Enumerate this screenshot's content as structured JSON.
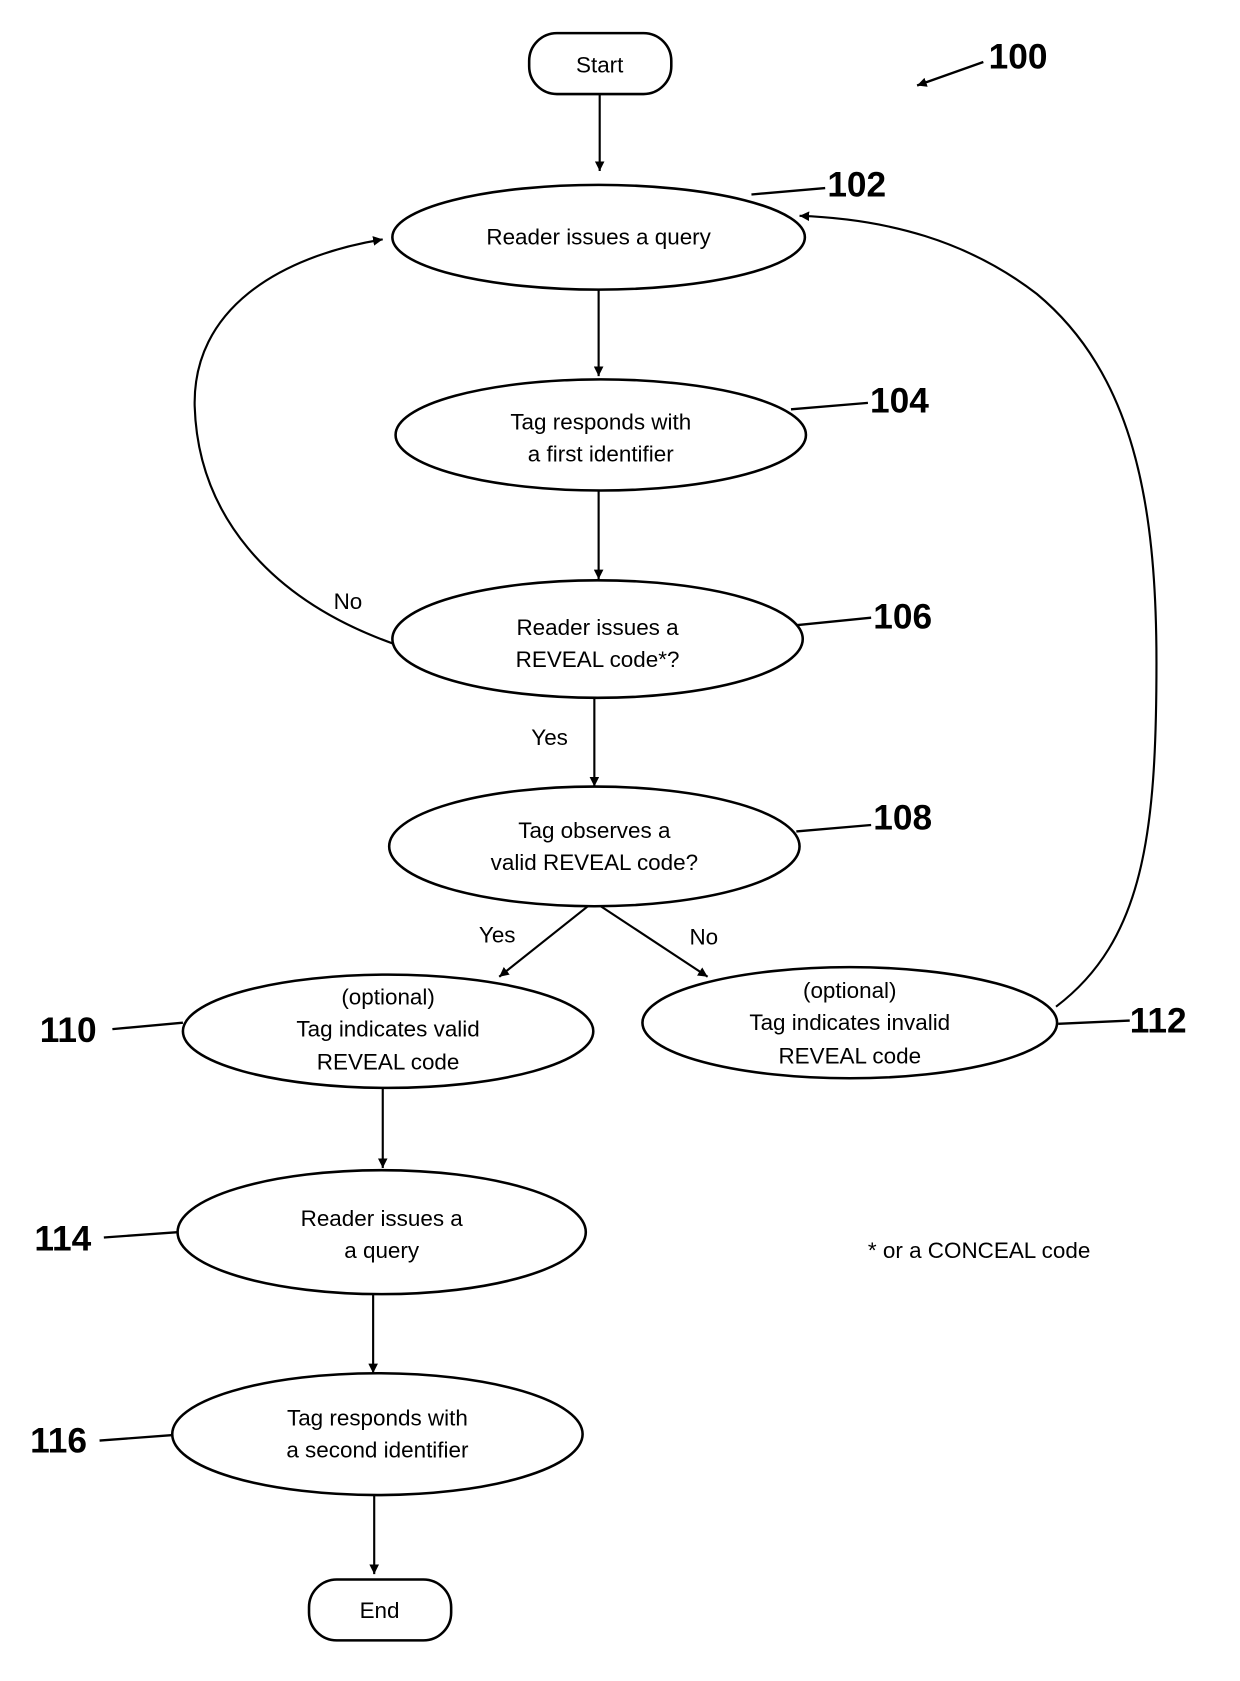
{
  "figure": {
    "reference": "100",
    "footnote": "* or a CONCEAL code"
  },
  "nodes": {
    "start": {
      "ref": "",
      "lines": [
        "Start"
      ]
    },
    "n102": {
      "ref": "102",
      "lines": [
        "Reader issues a query"
      ]
    },
    "n104": {
      "ref": "104",
      "lines": [
        "Tag responds with",
        "a first identifier"
      ]
    },
    "n106": {
      "ref": "106",
      "lines": [
        "Reader issues a",
        "REVEAL code*?"
      ]
    },
    "n108": {
      "ref": "108",
      "lines": [
        "Tag observes a",
        "valid REVEAL code?"
      ]
    },
    "n110": {
      "ref": "110",
      "lines": [
        "(optional)",
        "Tag indicates valid",
        "REVEAL code"
      ]
    },
    "n112": {
      "ref": "112",
      "lines": [
        "(optional)",
        "Tag indicates invalid",
        "REVEAL code"
      ]
    },
    "n114": {
      "ref": "114",
      "lines": [
        "Reader issues a",
        "a query"
      ]
    },
    "n116": {
      "ref": "116",
      "lines": [
        "Tag responds with",
        "a second identifier"
      ]
    },
    "end": {
      "ref": "",
      "lines": [
        "End"
      ]
    }
  },
  "edge_labels": {
    "n106_no": "No",
    "n106_yes": "Yes",
    "n108_yes": "Yes",
    "n108_no": "No"
  },
  "colors": {
    "ink": "#000000",
    "paper": "#ffffff"
  }
}
